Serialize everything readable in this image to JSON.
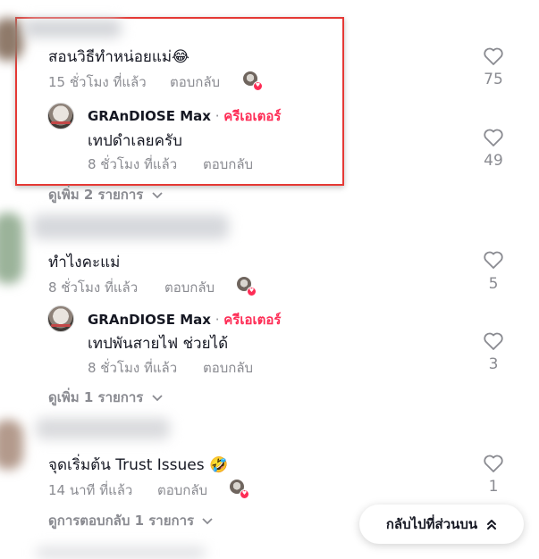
{
  "colors": {
    "accent": "#fe2c55",
    "highlight_border": "#e53935"
  },
  "comments": [
    {
      "text": "สอนวิธีทำหน่อยแม่",
      "emoji": "😂",
      "time": "15 ชั่วโมง ที่แล้ว",
      "reply_label": "ตอบกลับ",
      "likes": "75",
      "reply": {
        "author": "GRAnDIOSE Max",
        "separator": " · ",
        "badge": "ครีเอเตอร์",
        "text": "เทปดำเลยครับ",
        "time": "8 ชั่วโมง ที่แล้ว",
        "reply_label": "ตอบกลับ",
        "likes": "49"
      },
      "view_more": "ดูเพิ่ม 2 รายการ"
    },
    {
      "text": "ทำไงคะแม่",
      "time": "8 ชั่วโมง ที่แล้ว",
      "reply_label": "ตอบกลับ",
      "likes": "5",
      "reply": {
        "author": "GRAnDIOSE Max",
        "separator": " · ",
        "badge": "ครีเอเตอร์",
        "text": "เทปพันสายไฟ ช่วยได้",
        "time": "8 ชั่วโมง ที่แล้ว",
        "reply_label": "ตอบกลับ",
        "likes": "3"
      },
      "view_more": "ดูเพิ่ม 1 รายการ"
    },
    {
      "text": "จุดเริ่มต้น Trust Issues",
      "emoji": "🤣",
      "time": "14 นาที ที่แล้ว",
      "reply_label": "ตอบกลับ",
      "likes": "1",
      "view_more": "ดูการตอบกลับ 1 รายการ"
    }
  ],
  "back_to_top": {
    "label": "กลับไปที่ส่วนบน",
    "icon": "double-chevron-up-icon"
  }
}
